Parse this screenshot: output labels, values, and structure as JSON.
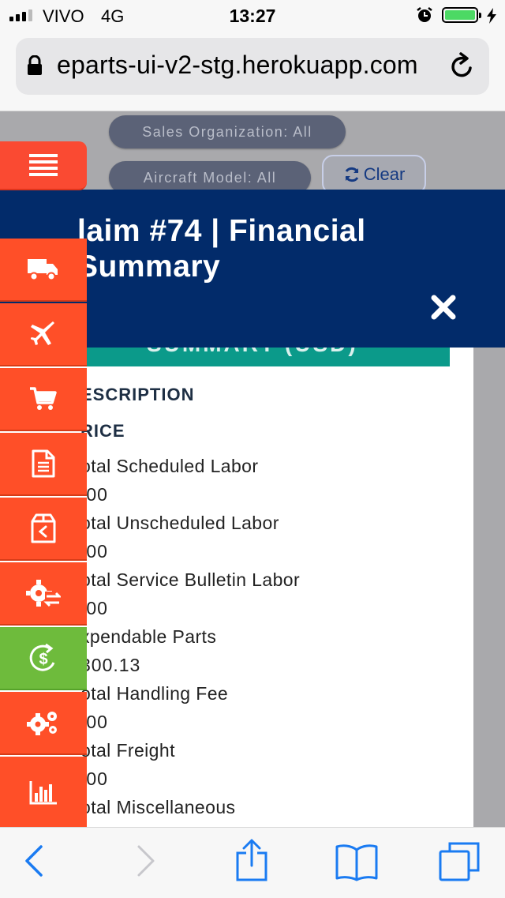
{
  "status_bar": {
    "carrier": "VIVO",
    "network": "4G",
    "time": "13:27",
    "battery_color": "#4cd964"
  },
  "browser": {
    "url": "eparts-ui-v2-stg.herokuapp.com",
    "reload_icon": "reload-icon",
    "lock_icon": "lock-icon"
  },
  "filters": {
    "sales_org": "Sales Organization: All",
    "aircraft_model": "Aircraft Model: All",
    "clear_label": "Clear"
  },
  "sidebar": {
    "items": [
      {
        "icon": "hamburger-menu-icon",
        "active": false
      },
      {
        "icon": "truck-icon",
        "active": false
      },
      {
        "icon": "airplane-icon",
        "active": false
      },
      {
        "icon": "shopping-cart-icon",
        "active": false
      },
      {
        "icon": "document-icon",
        "active": false
      },
      {
        "icon": "return-box-icon",
        "active": false
      },
      {
        "icon": "gear-exchange-icon",
        "active": false
      },
      {
        "icon": "dollar-cycle-icon",
        "active": true
      },
      {
        "icon": "gears-icon",
        "active": false
      },
      {
        "icon": "bar-chart-icon",
        "active": false
      }
    ],
    "accent": "#ff4f28",
    "active_color": "#6ebb3c"
  },
  "modal": {
    "title": "laim #74 | Financial Summary",
    "section_bar": "SUMMARY (USD)",
    "header_color": "#022b6a",
    "bar_color": "#0b9a8a"
  },
  "financial_summary": {
    "col_description": "ESCRIPTION",
    "col_price": "RICE",
    "rows": [
      {
        "label": "otal Scheduled Labor",
        "value": ".00"
      },
      {
        "label": "otal Unscheduled Labor",
        "value": ".00"
      },
      {
        "label": "otal Service Bulletin Labor",
        "value": ".00"
      },
      {
        "label": "xpendable Parts",
        "value": "300.13"
      },
      {
        "label": "otal Handling Fee",
        "value": ".00"
      },
      {
        "label": "otal Freight",
        "value": ".00"
      },
      {
        "label": "otal Miscellaneous",
        "value": ""
      }
    ]
  },
  "toolbar": {
    "icons": [
      "back-icon",
      "forward-icon",
      "share-icon",
      "bookmarks-icon",
      "tabs-icon"
    ],
    "tint": "#1a7bf2"
  }
}
